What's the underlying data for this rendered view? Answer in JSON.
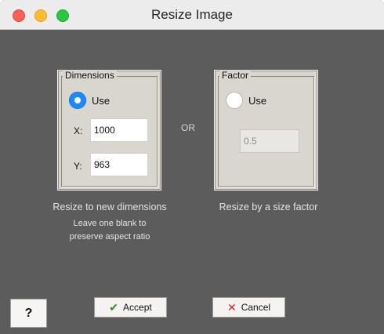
{
  "window": {
    "title": "Resize Image",
    "traffic_lights": [
      "close",
      "minimize",
      "zoom"
    ]
  },
  "dimensions": {
    "legend": "Dimensions",
    "use_label": "Use",
    "use_selected": true,
    "x_label": "X:",
    "x_value": "1000",
    "y_label": "Y:",
    "y_value": "963",
    "caption": "Resize to new dimensions",
    "note_line1": "Leave one blank to",
    "note_line2": "preserve aspect ratio"
  },
  "or_label": "OR",
  "factor": {
    "legend": "Factor",
    "use_label": "Use",
    "use_selected": false,
    "value": "0.5",
    "caption": "Resize by a size factor"
  },
  "buttons": {
    "help": "?",
    "accept": "Accept",
    "cancel": "Cancel"
  },
  "colors": {
    "window_bg": "#5c5c5c",
    "panel_bg": "#d9d5cf",
    "radio_selected": "#1a8cff",
    "accept_icon": "#2f8a1d",
    "cancel_icon": "#dd2222"
  },
  "icons": {
    "accept": "check-icon",
    "cancel": "x-icon"
  }
}
